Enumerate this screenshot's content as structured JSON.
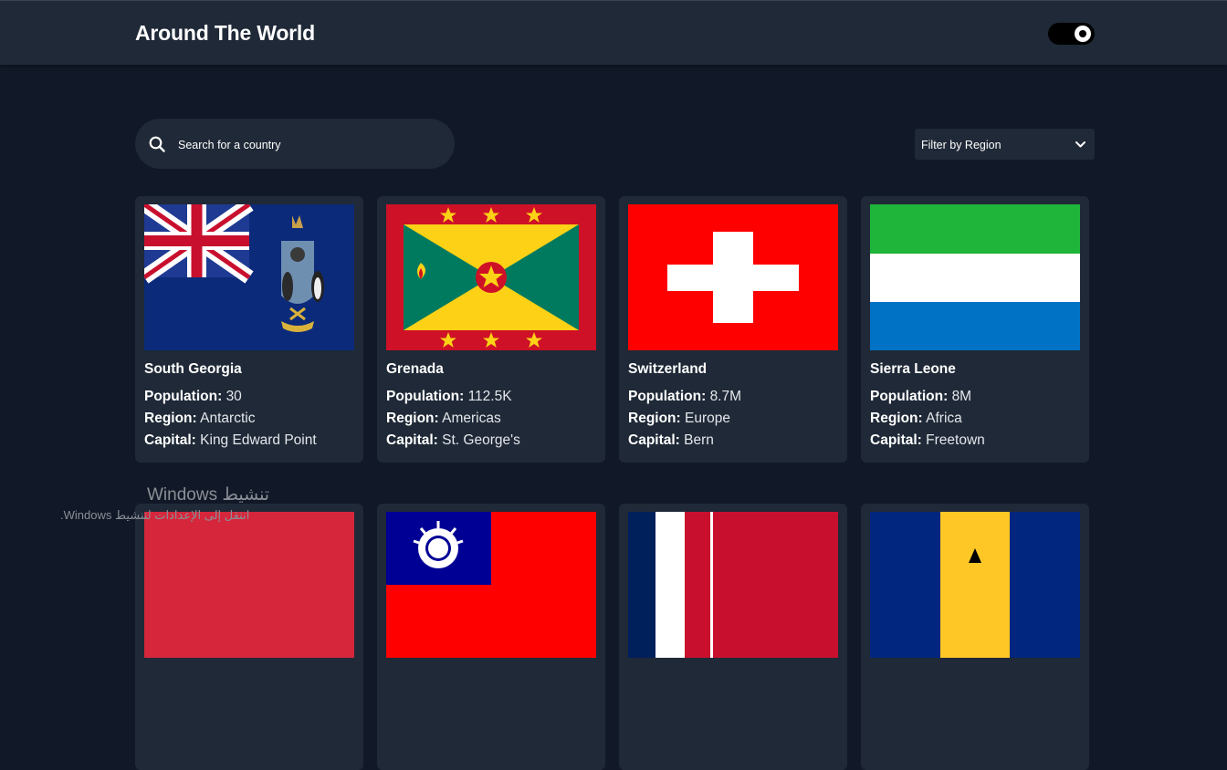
{
  "header": {
    "title": "Around The World"
  },
  "search": {
    "placeholder": "Search for a country"
  },
  "filter": {
    "label": "Filter by Region"
  },
  "labels": {
    "population": "Population:",
    "region": "Region:",
    "capital": "Capital:"
  },
  "countries": [
    {
      "name": "South Georgia",
      "population": "30",
      "region": "Antarctic",
      "capital": "King Edward Point"
    },
    {
      "name": "Grenada",
      "population": "112.5K",
      "region": "Americas",
      "capital": "St. George's"
    },
    {
      "name": "Switzerland",
      "population": "8.7M",
      "region": "Europe",
      "capital": "Bern"
    },
    {
      "name": "Sierra Leone",
      "population": "8M",
      "region": "Africa",
      "capital": "Freetown"
    }
  ],
  "watermark": {
    "title": "تنشيط Windows",
    "subtitle": "انتقل إلى الإعدادات لتنشيط Windows."
  },
  "colors": {
    "background": "#111827",
    "surface": "#1f2937",
    "text": "#ffffff"
  }
}
